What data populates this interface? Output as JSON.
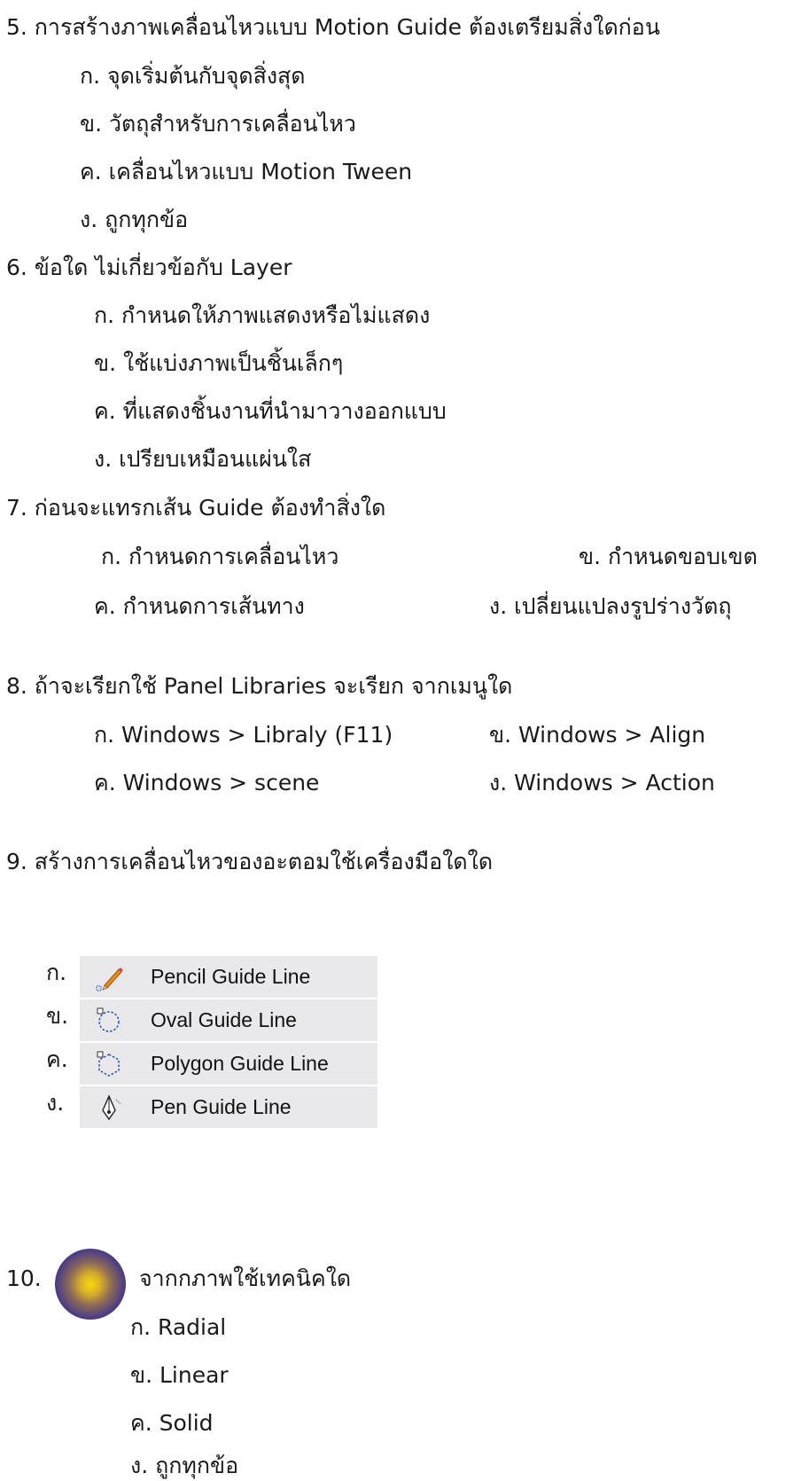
{
  "q5": {
    "question": "5. การสร้างภาพเคลื่อนไหวแบบ   Motion Guide ต้องเตรียมสิ่งใดก่อน",
    "options": [
      "ก. จุดเริ่มต้นกับจุดสิ่งสุด",
      "ข. วัตถุสำหรับการเคลื่อนไหว",
      "ค. เคลื่อนไหวแบบ Motion Tween",
      "ง. ถูกทุกข้อ"
    ]
  },
  "q6": {
    "question": "6. ข้อใด ไม่เกี่ยวข้อกับ Layer",
    "options": [
      "ก. กำหนดให้ภาพแสดงหรือไม่แสดง",
      "ข. ใช้แบ่งภาพเป็นชิ้นเล็กๆ",
      "ค. ที่แสดงชิ้นงานที่นำมาวางออกแบบ",
      "ง. เปรียบเหมือนแผ่นใส"
    ]
  },
  "q7": {
    "question": "7. ก่อนจะแทรกเส้น Guide ต้องทำสิ่งใด",
    "options": [
      "ก. กำหนดการเคลื่อนไหว",
      "ข. กำหนดขอบเขต",
      "ค. กำหนดการเส้นทาง",
      "ง. เปลี่ยนแปลงรูปร่างวัตถุ"
    ]
  },
  "q8": {
    "question": "8. ถ้าจะเรียกใช้ Panel Libraries จะเรียก จากเมนูใด",
    "options": [
      "ก. Windows > Libraly (F11)",
      "ข. Windows > Align",
      "ค. Windows > scene",
      "ง. Windows > Action"
    ]
  },
  "q9": {
    "question": "9. สร้างการเคลื่อนไหวของอะตอมใช้เครื่องมือใดใด",
    "options": [
      {
        "marker": "ก.",
        "label": "Pencil Guide Line",
        "icon": "pencil-icon"
      },
      {
        "marker": "ข.",
        "label": "Oval Guide Line",
        "icon": "oval-icon"
      },
      {
        "marker": "ค.",
        "label": "Polygon Guide Line",
        "icon": "polygon-icon"
      },
      {
        "marker": "ง.",
        "label": "Pen Guide Line",
        "icon": "pen-icon"
      }
    ]
  },
  "q10": {
    "number": "10.",
    "question": "จากกภาพใช้เทคนิคใด",
    "image": "radial-gradient-ball",
    "options": [
      "ก. Radial",
      "ข. Linear",
      "ค. Solid",
      "ง. ถูกทุกข้อ"
    ]
  },
  "colors": {
    "tool_bg": "#e9e9ec",
    "ball_center": "#f6d80a",
    "ball_edge": "#2a2f94"
  }
}
